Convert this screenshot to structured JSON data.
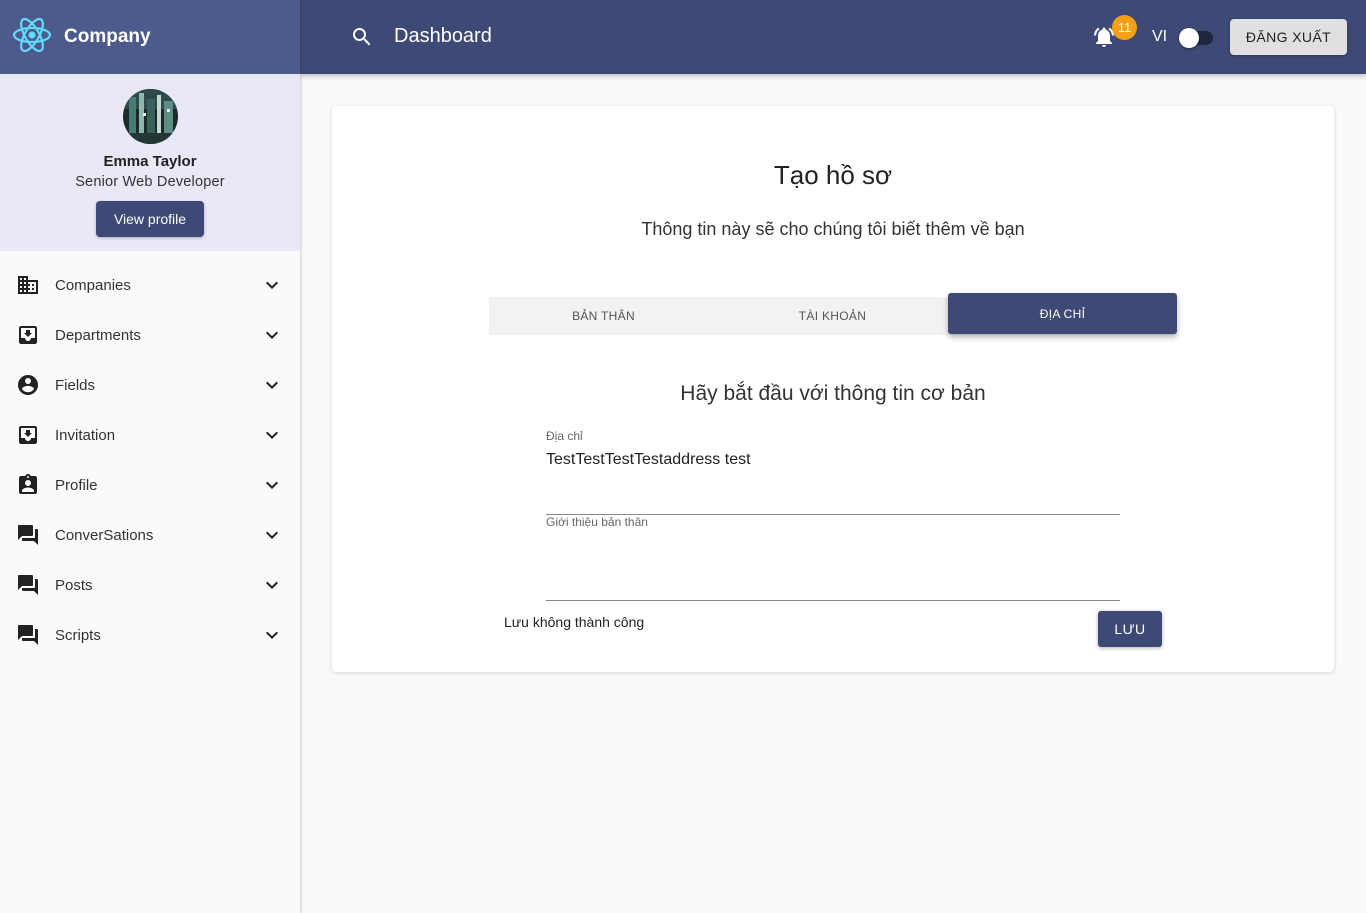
{
  "brand": {
    "name": "Company",
    "logo_icon": "react-atom-icon",
    "color": "#61dafb"
  },
  "user": {
    "name": "Emma Taylor",
    "role": "Senior Web Developer",
    "view_profile_label": "View profile"
  },
  "sidebar": {
    "items": [
      {
        "label": "Companies",
        "icon": "domain-icon"
      },
      {
        "label": "Departments",
        "icon": "inbox-icon"
      },
      {
        "label": "Fields",
        "icon": "account-circle-icon"
      },
      {
        "label": "Invitation",
        "icon": "inbox-icon"
      },
      {
        "label": "Profile",
        "icon": "assignment-ind-icon"
      },
      {
        "label": "ConverSations",
        "icon": "forum-icon"
      },
      {
        "label": "Posts",
        "icon": "forum-icon"
      },
      {
        "label": "Scripts",
        "icon": "forum-icon"
      }
    ]
  },
  "topbar": {
    "title": "Dashboard",
    "notification_count": "11",
    "language": "VI",
    "logout_label": "ĐĂNG XUẤT",
    "dark_mode_on": false
  },
  "form": {
    "title": "Tạo hồ sơ",
    "subtitle": "Thông tin này sẽ cho chúng tôi biết thêm về bạn",
    "tabs": [
      {
        "label": "BẢN THÂN",
        "active": false
      },
      {
        "label": "TÀI KHOẢN",
        "active": false
      },
      {
        "label": "ĐỊA CHỈ",
        "active": true
      }
    ],
    "section_heading": "Hãy bắt đầu với thông tin cơ bản",
    "address_label": "Địa chỉ",
    "address_value": "TestTestTestTestaddress test",
    "bio_label": "Giới thiệu bản thân",
    "bio_value": "",
    "status_message": "Lưu không thành công",
    "save_label": "LƯU"
  },
  "colors": {
    "brand_bar": "#4d5b8c",
    "topbar": "#3e4a75",
    "primary": "#3e4a75",
    "profile_bg": "#e8e8f6",
    "badge": "#f59f19"
  }
}
